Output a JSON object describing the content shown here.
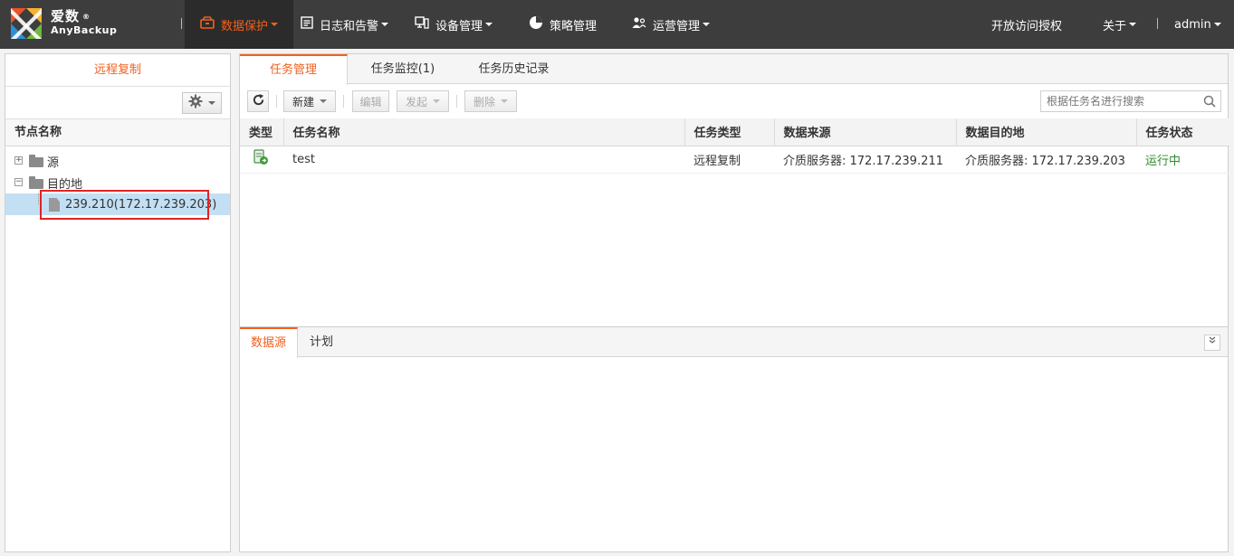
{
  "app": {
    "logo_cn": "爱数",
    "logo_en": "AnyBackup",
    "logo_mark": "®"
  },
  "nav": {
    "items": [
      {
        "label": "数据保护",
        "icon": "data-protect-icon"
      },
      {
        "label": "日志和告警",
        "icon": "log-icon"
      },
      {
        "label": "设备管理",
        "icon": "device-icon"
      },
      {
        "label": "策略管理",
        "icon": "pie-icon"
      },
      {
        "label": "运营管理",
        "icon": "users-icon"
      }
    ],
    "right": {
      "access": "开放访问授权",
      "about": "关于",
      "user": "admin"
    },
    "active_color": "#f0611e"
  },
  "left": {
    "title": "远程复制",
    "tree_header": "节点名称",
    "nodes": {
      "source": "源",
      "destination": "目的地",
      "child": "239.210(172.17.239.203)"
    }
  },
  "tabs": [
    "任务管理",
    "任务监控(1)",
    "任务历史记录"
  ],
  "toolbar": {
    "new": "新建",
    "edit": "编辑",
    "launch": "发起",
    "delete": "删除",
    "search_placeholder": "根据任务名进行搜索"
  },
  "table": {
    "headers": [
      "类型",
      "任务名称",
      "任务类型",
      "数据来源",
      "数据目的地",
      "任务状态"
    ],
    "rows": [
      {
        "name": "test",
        "type": "远程复制",
        "source": "介质服务器: 172.17.239.211",
        "dest": "介质服务器: 172.17.239.203",
        "status": "运行中"
      }
    ]
  },
  "lower_tabs": [
    "数据源",
    "计划"
  ]
}
